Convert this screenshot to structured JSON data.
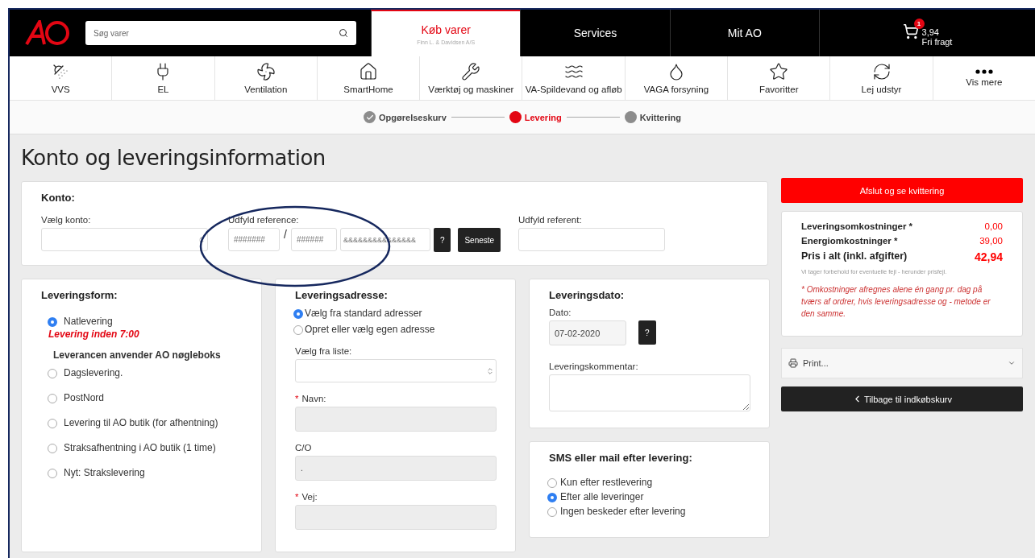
{
  "header": {
    "search": {
      "placeholder": "Søg varer"
    },
    "tabs": [
      {
        "label": "Køb varer",
        "sub": "Finn L. & Davidsen A/S",
        "selected": true
      },
      {
        "label": "Services",
        "selected": false
      },
      {
        "label": "Mit AO",
        "selected": false
      }
    ],
    "cart": {
      "badge": "1",
      "amount": "3,94",
      "note": "Fri fragt"
    }
  },
  "categories": [
    "VVS",
    "EL",
    "Ventilation",
    "SmartHome",
    "Værktøj og maskiner",
    "VA-Spildevand og afløb",
    "VAGA forsyning",
    "Favoritter",
    "Lej udstyr",
    "Vis mere"
  ],
  "steps": [
    {
      "label": "Opgørelseskurv",
      "completed": true,
      "selected": false
    },
    {
      "label": "Levering",
      "completed": false,
      "selected": true
    },
    {
      "label": "Kvittering",
      "completed": false,
      "selected": false
    }
  ],
  "title": "Konto og leveringsinformation",
  "konto": {
    "heading": "Konto:",
    "account_label": "Vælg konto:",
    "reference_label": "Udfyld reference:",
    "ref_placeholders": [
      "#######",
      "######",
      "&&&&&&&&&&&&&&&"
    ],
    "separator": "/",
    "help": "?",
    "recent": "Seneste",
    "referent_label": "Udfyld referent:"
  },
  "leveringsform": {
    "heading": "Leveringsform:",
    "options": [
      {
        "label": "Natlevering",
        "selected": true,
        "note": "Levering inden 7:00",
        "info": "Leverancen anvender AO nøgleboks"
      },
      {
        "label": "Dagslevering.",
        "selected": false
      },
      {
        "label": "PostNord",
        "selected": false
      },
      {
        "label": "Levering til AO butik (for afhentning)",
        "selected": false
      },
      {
        "label": "Straksafhentning i AO butik (1 time)",
        "selected": false
      },
      {
        "label": "Nyt: Strakslevering",
        "selected": false
      }
    ]
  },
  "adresse": {
    "heading": "Leveringsadresse:",
    "options": [
      {
        "label": "Vælg fra standard adresser",
        "selected": true
      },
      {
        "label": "Opret eller vælg egen adresse",
        "selected": false
      }
    ],
    "list_label": "Vælg fra liste:",
    "fields": [
      {
        "label": "Navn:",
        "marker": "*"
      },
      {
        "label": "C/O",
        "value": "."
      },
      {
        "label": "Vej:",
        "marker": "*"
      }
    ]
  },
  "dato": {
    "heading": "Leveringsdato:",
    "date_label": "Dato:",
    "date": "07-02-2020",
    "help": "?",
    "comment_label": "Leveringskommentar:"
  },
  "sms": {
    "heading": "SMS eller mail efter levering:",
    "options": [
      {
        "label": "Kun efter restlevering",
        "selected": false
      },
      {
        "label": "Efter alle leveringer",
        "selected": true
      },
      {
        "label": "Ingen beskeder efter levering",
        "selected": false
      }
    ]
  },
  "summary": {
    "finish": "Afslut og se kvittering",
    "lines": [
      {
        "label": "Leveringsomkostninger *",
        "value": "0,00",
        "total": false
      },
      {
        "label": "Energiomkostninger *",
        "value": "39,00",
        "total": false
      },
      {
        "label": "Pris i alt (inkl. afgifter)",
        "value": "42,94",
        "total": true
      }
    ],
    "disclaimer": "Vi tager forbehold for eventuelle fejl - herunder prisfejl.",
    "footnote": "* Omkostninger afregnes alene én gang pr. dag på tværs af ordrer, hvis leveringsadresse og - metode er den samme.",
    "print": "Print...",
    "back": "Tilbage til indkøbskurv"
  }
}
